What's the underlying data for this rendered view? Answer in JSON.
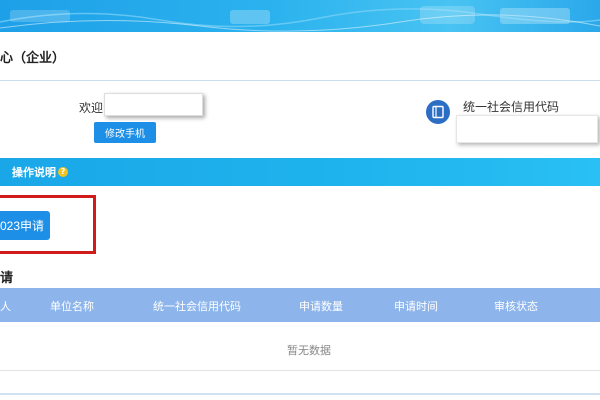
{
  "header": {
    "title": "心（企业）"
  },
  "user": {
    "welcome_label": "欢迎",
    "name_value": "",
    "change_phone_label": "修改手机",
    "credit_code_label": "统一社会信用代码",
    "credit_code_value": ""
  },
  "info_bar": {
    "label": "操作说明",
    "help_icon": "question-icon",
    "help_glyph": "?"
  },
  "apply": {
    "button_label": "023申请"
  },
  "section": {
    "title": "请"
  },
  "table": {
    "headers": [
      "人",
      "单位名称",
      "统一社会信用代码",
      "申请数量",
      "申请时间",
      "审核状态"
    ],
    "empty_text": "暂无数据"
  },
  "colors": {
    "accent": "#1e8fe6",
    "info_bar": "#1fb4ed",
    "table_header": "#8db5eb",
    "highlight": "#d11a1a"
  }
}
